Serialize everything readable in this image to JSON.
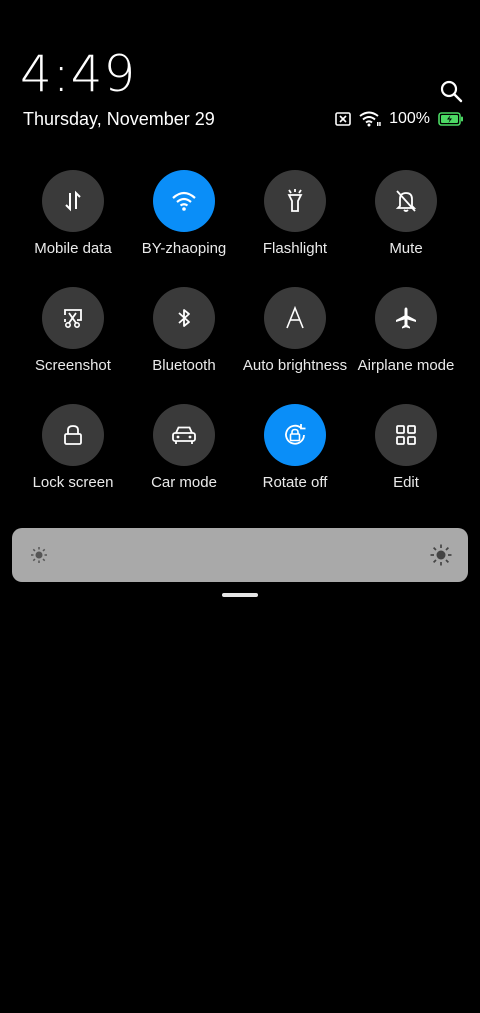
{
  "header": {
    "time": "4:49",
    "date": "Thursday, November 29"
  },
  "status_bar": {
    "battery_percent": "100%",
    "icons": [
      "no-sim-icon",
      "wifi-icon",
      "battery-charging-icon"
    ]
  },
  "tiles": [
    {
      "label": "Mobile data",
      "icon": "mobile-data-icon",
      "active": false
    },
    {
      "label": "BY-zhaoping",
      "icon": "wifi-icon",
      "active": true
    },
    {
      "label": "Flashlight",
      "icon": "flashlight-icon",
      "active": false
    },
    {
      "label": "Mute",
      "icon": "bell-off-icon",
      "active": false
    },
    {
      "label": "Screenshot",
      "icon": "screenshot-icon",
      "active": false
    },
    {
      "label": "Bluetooth",
      "icon": "bluetooth-icon",
      "active": false
    },
    {
      "label": "Auto brightness",
      "icon": "auto-brightness-icon",
      "active": false
    },
    {
      "label": "Airplane mode",
      "icon": "airplane-icon",
      "active": false
    },
    {
      "label": "Lock screen",
      "icon": "lock-icon",
      "active": false
    },
    {
      "label": "Car mode",
      "icon": "car-icon",
      "active": false
    },
    {
      "label": "Rotate off",
      "icon": "rotate-lock-icon",
      "active": true
    },
    {
      "label": "Edit",
      "icon": "grid-icon",
      "active": false
    }
  ],
  "colors": {
    "active_tile": "#0a8ef8",
    "inactive_tile": "#3a3a3a",
    "slider_track": "#a9a9a9",
    "battery": "#4cd964"
  },
  "brightness": {
    "level": 0.0,
    "min_icon": "sun-small-icon",
    "max_icon": "sun-large-icon"
  }
}
